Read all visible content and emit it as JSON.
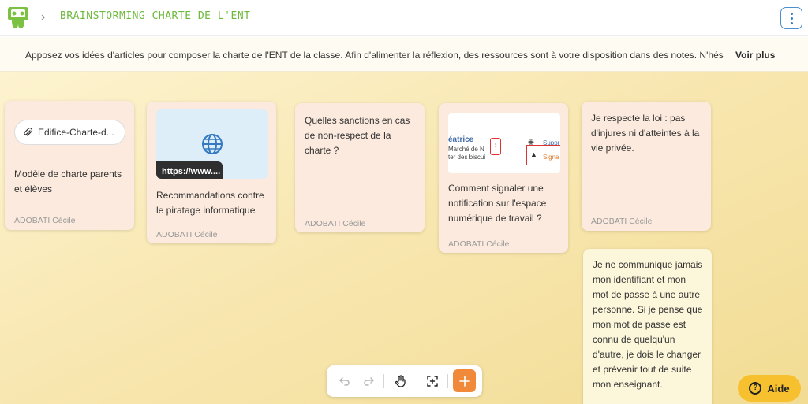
{
  "header": {
    "title": "BRAINSTORMING CHARTE DE L'ENT",
    "logo_icon": "ent-logo-icon",
    "breadcrumb_icon": "chevron-right-icon",
    "menu_icon": "kebab-menu-icon"
  },
  "description": {
    "text": "Apposez vos idées d'articles pour composer la charte de l'ENT de la classe. Afin d'alimenter la réflexion, des ressources sont à votre disposition dans des notes. N'hési…",
    "more_label": "Voir plus"
  },
  "cards": [
    {
      "attachment_label": "Edifice-Charte-d...",
      "attachment_icon": "paperclip-icon",
      "text": "Modèle de charte parents et élèves",
      "author": "ADOBATI Cécile"
    },
    {
      "link_url": "https://www....",
      "link_icon": "globe-icon",
      "text": "Recommandations contre le piratage informatique",
      "author": "ADOBATI Cécile"
    },
    {
      "text": "Quelles sanctions en cas de non-respect de la charte ?",
      "author": "ADOBATI Cécile"
    },
    {
      "screenshot": {
        "name": "éatrice",
        "line1": "Marché de N",
        "line2": "ter des biscui",
        "action1": "Suppr",
        "action2": "Signa"
      },
      "text": "Comment signaler une notification sur l'espace numérique de travail ?",
      "author": "ADOBATI Cécile"
    },
    {
      "text": "Je respecte la loi : pas d'injures ni d'atteintes à la vie privée.",
      "author": "ADOBATI Cécile"
    },
    {
      "text": "Je ne communique jamais mon identifiant et mon mot de passe à une autre personne. Si je pense que mon mot de passe est connu de quelqu'un d'autre, je dois le changer et prévenir tout de suite mon enseignant."
    }
  ],
  "toolbar": {
    "undo_icon": "undo-icon",
    "redo_icon": "redo-icon",
    "pan_icon": "hand-icon",
    "fit_icon": "fit-screen-icon",
    "add_icon": "plus-icon"
  },
  "help": {
    "label": "Aide",
    "icon_glyph": "?"
  },
  "colors": {
    "accent_green": "#6cba3c",
    "add_button": "#f0893a",
    "help_button": "#f6c02f",
    "card_pink": "#fbeadd",
    "card_cream": "#fcf6da"
  }
}
